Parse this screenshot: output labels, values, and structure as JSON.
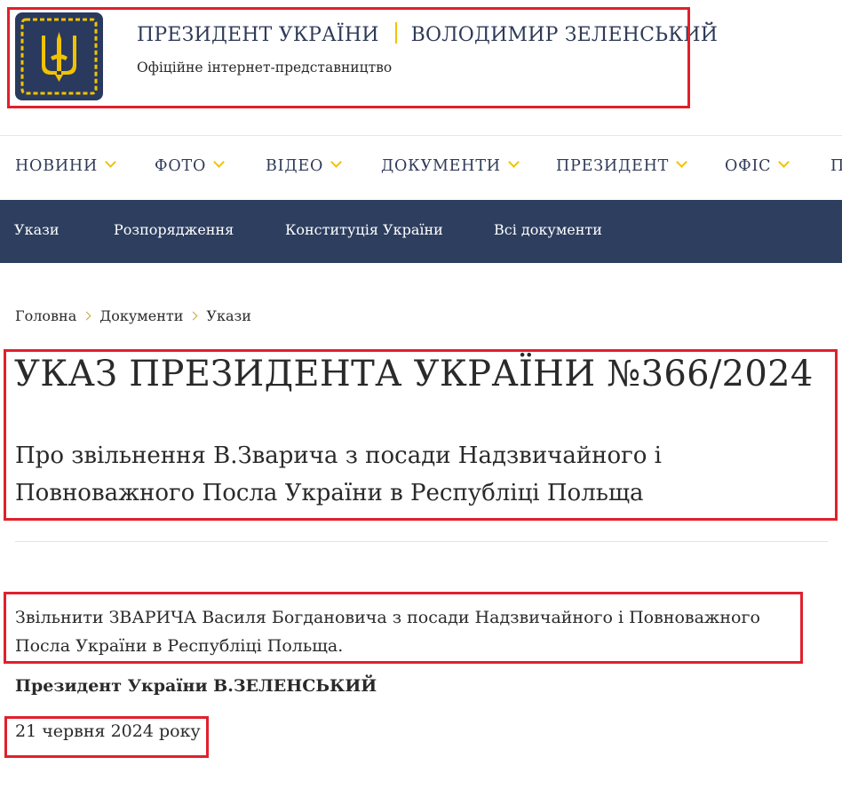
{
  "header": {
    "title_left": "ПРЕЗИДЕНТ УКРАЇНИ",
    "title_right": "ВОЛОДИМИР ЗЕЛЕНСЬКИЙ",
    "subtitle": "Офіційне інтернет-представництво",
    "logo_icon": "trident-emblem-icon",
    "colors": {
      "navy": "#2d3e5f",
      "gold": "#f2c200",
      "highlight": "#e0202c"
    }
  },
  "main_nav": [
    "НОВИНИ",
    "ФОТО",
    "ВІДЕО",
    "ДОКУМЕНТИ",
    "ПРЕЗИДЕНТ",
    "ОФІС",
    "П"
  ],
  "sub_nav": [
    "Укази",
    "Розпорядження",
    "Конституція України",
    "Всі документи"
  ],
  "breadcrumb": [
    "Головна",
    "Документи",
    "Укази"
  ],
  "decree": {
    "title": "УКАЗ ПРЕЗИДЕНТА УКРАЇНИ №366/2024",
    "subtitle": "Про звільнення В.Зварича з посади Надзвичайного і Повноважного Посла України в Республіці Польща",
    "text": "Звільнити ЗВАРИЧА Василя Богдановича з посади Надзвичайного і Повноважного Посла України в Республіці Польща.",
    "signature": "Президент України В.ЗЕЛЕНСЬКИЙ",
    "date": "21 червня 2024 року"
  }
}
